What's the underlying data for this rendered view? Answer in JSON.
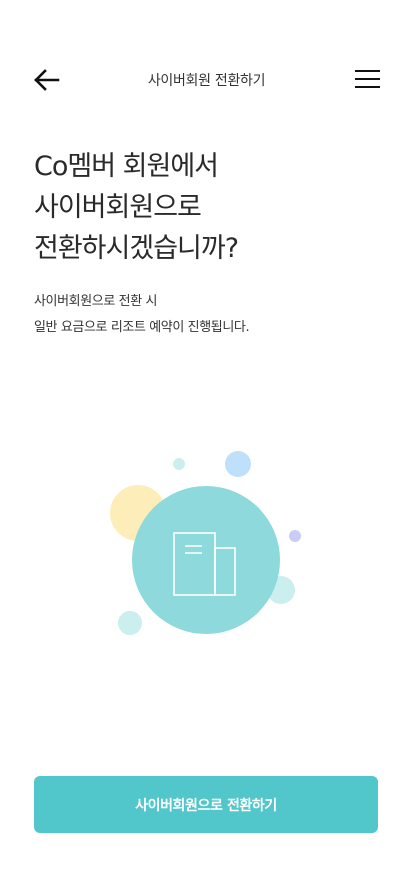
{
  "header": {
    "title": "사이버회원 전환하기",
    "back_icon": "arrow-left-icon",
    "menu_icon": "hamburger-menu-icon"
  },
  "main": {
    "headline": [
      "Co멤버 회원에서",
      "사이버회원으로",
      "전환하시겠습니까?"
    ],
    "description": [
      "사이버회원으로 전환 시",
      "일반 요금으로 리조트 예약이 진행됩니다."
    ]
  },
  "illustration": {
    "icon": "document-icon",
    "colors": {
      "main_circle": "#8ed9db",
      "yellow": "#fdeeb9",
      "blue": "#bfe0fb",
      "purple": "#c9cdf5",
      "teal_light": "#cbeeee"
    }
  },
  "cta": {
    "label": "사이버회원으로 전환하기",
    "color": "#52c7cb"
  }
}
